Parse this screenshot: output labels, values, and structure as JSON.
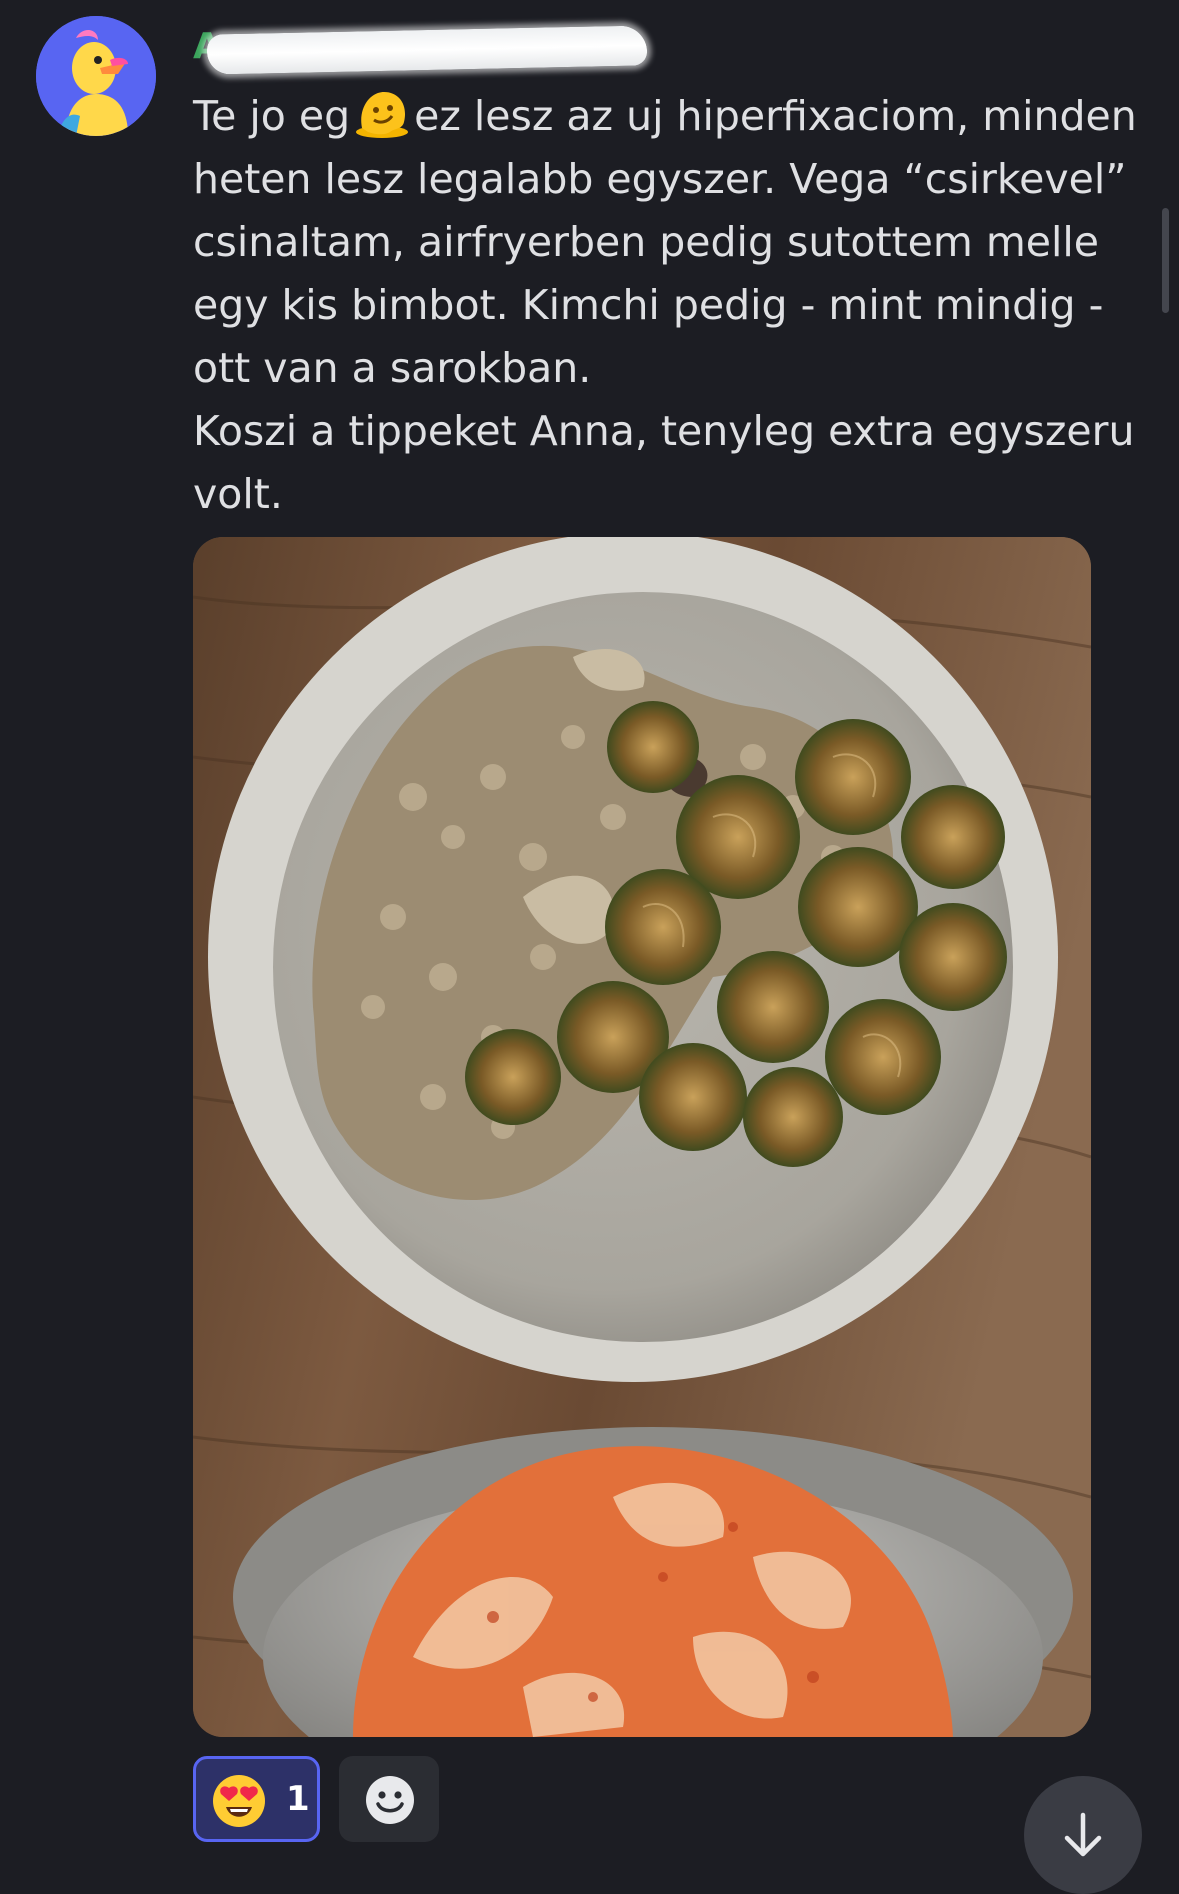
{
  "author": {
    "name": "A"
  },
  "message": {
    "lines": [
      {
        "before": "Te jo eg",
        "emoji": "melting-face-emoji",
        "after": "ez lesz az uj hiperfixaciom, minden heten lesz legalabb egyszer. Vega “csirkevel” csinaltam, airfryerben pedig sutottem melle egy kis bimbot. Kimchi pedig - mint mindig - ott van a sarokban."
      },
      {
        "text": "Koszi a tippeket Anna, tenyleg extra egyszeru volt."
      }
    ]
  },
  "reactions": [
    {
      "emoji": "heart-eyes-emoji",
      "count": "1",
      "selected": true
    }
  ],
  "add_reaction_icon": "smiley-plus-icon",
  "scroll_icon": "arrow-down-icon",
  "colors": {
    "background": "#1c1d23",
    "text": "#dfe0e3",
    "author": "#3ba55c",
    "reaction_border": "#5865f2",
    "reaction_bg": "#2d3168"
  }
}
